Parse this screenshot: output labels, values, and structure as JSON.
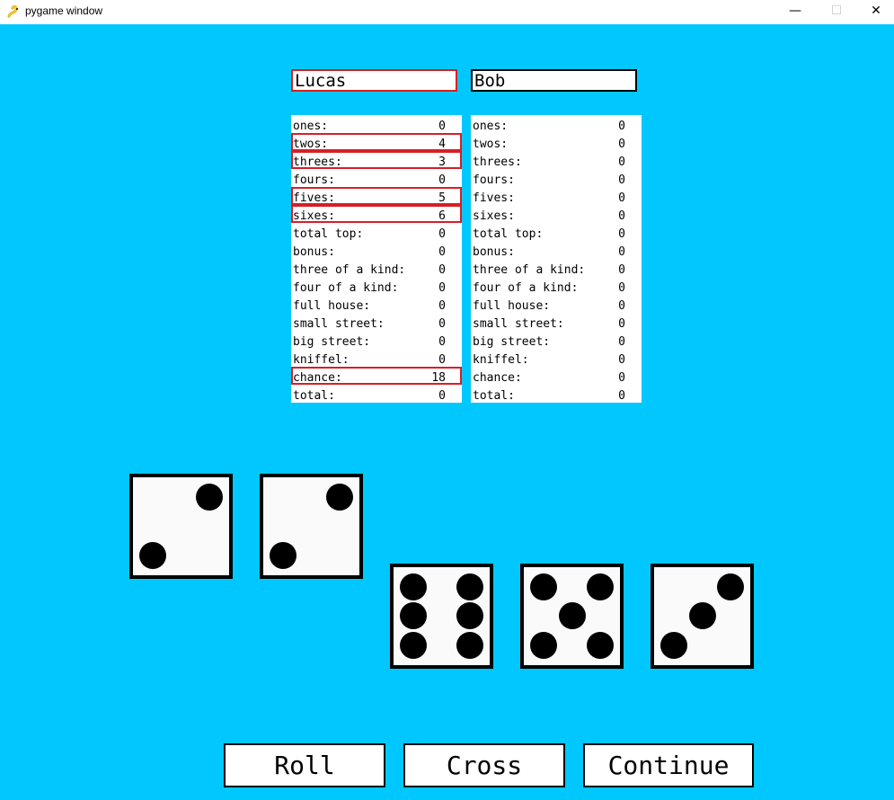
{
  "window": {
    "title": "pygame window",
    "buttons": [
      "—",
      "☐",
      "✕"
    ],
    "app_icon": "snake-icon"
  },
  "players": [
    {
      "name": "Lucas",
      "active": true
    },
    {
      "name": "Bob",
      "active": false
    }
  ],
  "scorecards": [
    {
      "rows": [
        {
          "label": "ones:",
          "value": "0",
          "selected": false
        },
        {
          "label": "twos:",
          "value": "4",
          "selected": true
        },
        {
          "label": "threes:",
          "value": "3",
          "selected": true
        },
        {
          "label": "fours:",
          "value": "0",
          "selected": false
        },
        {
          "label": "fives:",
          "value": "5",
          "selected": true
        },
        {
          "label": "sixes:",
          "value": "6",
          "selected": true
        },
        {
          "label": "total top:",
          "value": "0",
          "selected": false
        },
        {
          "label": "bonus:",
          "value": "0",
          "selected": false
        },
        {
          "label": "three of a kind:",
          "value": "0",
          "selected": false
        },
        {
          "label": "four of a kind:",
          "value": "0",
          "selected": false
        },
        {
          "label": "full house:",
          "value": "0",
          "selected": false
        },
        {
          "label": "small street:",
          "value": "0",
          "selected": false
        },
        {
          "label": "big street:",
          "value": "0",
          "selected": false
        },
        {
          "label": "kniffel:",
          "value": "0",
          "selected": false
        },
        {
          "label": "chance:",
          "value": "18",
          "selected": true
        },
        {
          "label": "total:",
          "value": "0",
          "selected": false
        }
      ]
    },
    {
      "rows": [
        {
          "label": "ones:",
          "value": "0",
          "selected": false
        },
        {
          "label": "twos:",
          "value": "0",
          "selected": false
        },
        {
          "label": "threes:",
          "value": "0",
          "selected": false
        },
        {
          "label": "fours:",
          "value": "0",
          "selected": false
        },
        {
          "label": "fives:",
          "value": "0",
          "selected": false
        },
        {
          "label": "sixes:",
          "value": "0",
          "selected": false
        },
        {
          "label": "total top:",
          "value": "0",
          "selected": false
        },
        {
          "label": "bonus:",
          "value": "0",
          "selected": false
        },
        {
          "label": "three of a kind:",
          "value": "0",
          "selected": false
        },
        {
          "label": "four of a kind:",
          "value": "0",
          "selected": false
        },
        {
          "label": "full house:",
          "value": "0",
          "selected": false
        },
        {
          "label": "small street:",
          "value": "0",
          "selected": false
        },
        {
          "label": "big street:",
          "value": "0",
          "selected": false
        },
        {
          "label": "kniffel:",
          "value": "0",
          "selected": false
        },
        {
          "label": "chance:",
          "value": "0",
          "selected": false
        },
        {
          "label": "total:",
          "value": "0",
          "selected": false
        }
      ]
    }
  ],
  "dice": [
    {
      "value": 2,
      "held": true
    },
    {
      "value": 2,
      "held": true
    },
    {
      "value": 6,
      "held": false
    },
    {
      "value": 5,
      "held": false
    },
    {
      "value": 3,
      "held": false
    }
  ],
  "buttons": {
    "roll": "Roll",
    "cross": "Cross",
    "continue": "Continue"
  },
  "colors": {
    "background": "#00c8ff",
    "selected_border": "#d61f26",
    "panel": "#ffffff",
    "pip": "#000000"
  }
}
